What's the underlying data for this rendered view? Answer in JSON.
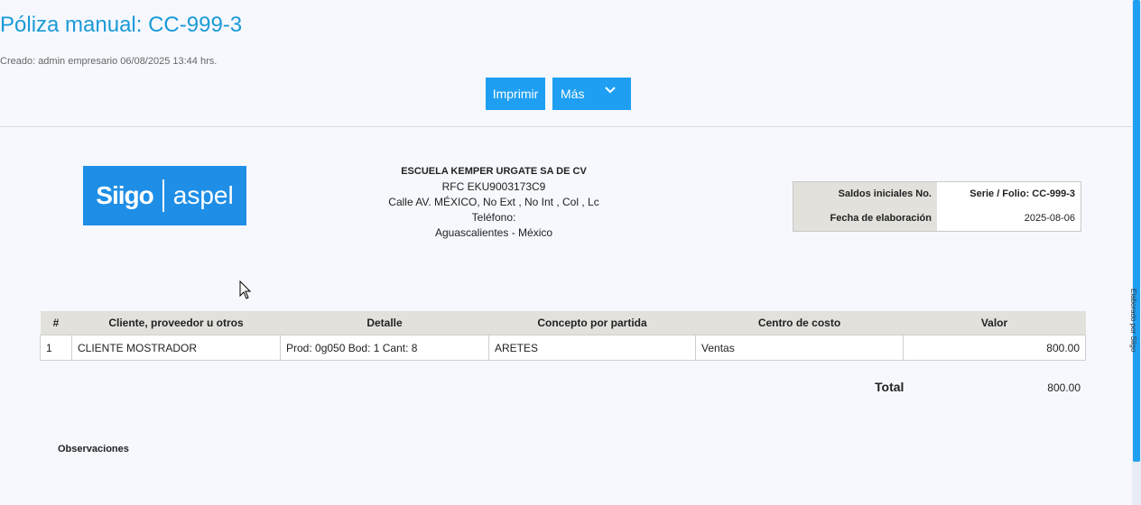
{
  "header": {
    "title": "Póliza manual: CC-999-3",
    "created": "Creado: admin empresario 06/08/2025 13:44 hrs."
  },
  "toolbar": {
    "print_label": "Imprimir",
    "more_label": "Más"
  },
  "logo": {
    "text_left": "Siigo",
    "text_right": "aspel"
  },
  "company": {
    "name": "ESCUELA KEMPER URGATE SA DE CV",
    "rfc": "RFC EKU9003173C9",
    "address": "Calle AV. MÉXICO, No Ext , No Int , Col , Lc",
    "phone": "Teléfono:",
    "location": "Aguascalientes - México"
  },
  "info": {
    "row1_label": "Saldos iniciales No.",
    "row1_value": "Serie / Folio: CC-999-3",
    "row2_label": "Fecha de elaboración",
    "row2_value": "2025-08-06"
  },
  "table": {
    "headers": [
      "#",
      "Cliente, proveedor u otros",
      "Detalle",
      "Concepto por partida",
      "Centro de costo",
      "Valor"
    ],
    "rows": [
      [
        "1",
        "CLIENTE MOSTRADOR",
        "Prod: 0g050 Bod: 1 Cant: 8",
        "ARETES",
        "Ventas",
        "800.00"
      ]
    ]
  },
  "totals": {
    "label": "Total",
    "value": "800.00"
  },
  "observations": {
    "label": "Observaciones"
  },
  "sidebar": {
    "vertical_text": "Elaborado por Siigo"
  },
  "colors": {
    "accent": "#1e9ff2",
    "title": "#1a9ad6",
    "header_bg": "#e2e1dc",
    "page_bg": "#f6f8fe"
  }
}
